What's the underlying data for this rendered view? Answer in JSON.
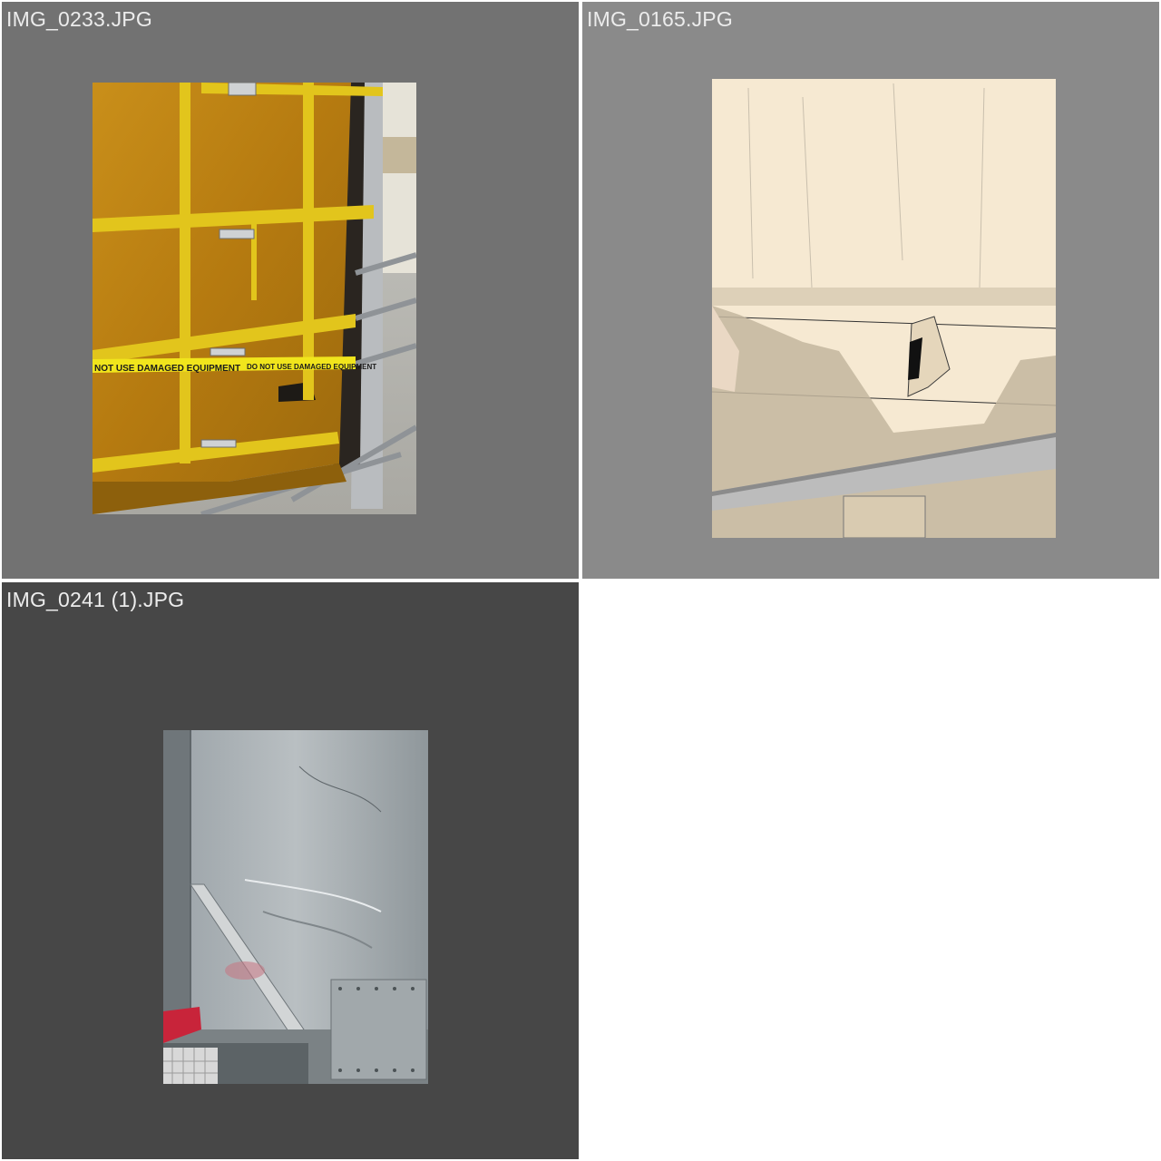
{
  "tiles": [
    {
      "filename": "IMG_0233.JPG",
      "background": "#727272"
    },
    {
      "filename": "IMG_0165.JPG",
      "background": "#8a8a8a"
    },
    {
      "filename": "IMG_0241 (1).JPG",
      "background": "#474747"
    }
  ],
  "photos": {
    "img_0233": {
      "tape_text_left": "NOT USE DAMAGED EQUIPMENT",
      "tape_text_right": "DO NOT USE DAMAGED EQUIPMENT"
    }
  }
}
